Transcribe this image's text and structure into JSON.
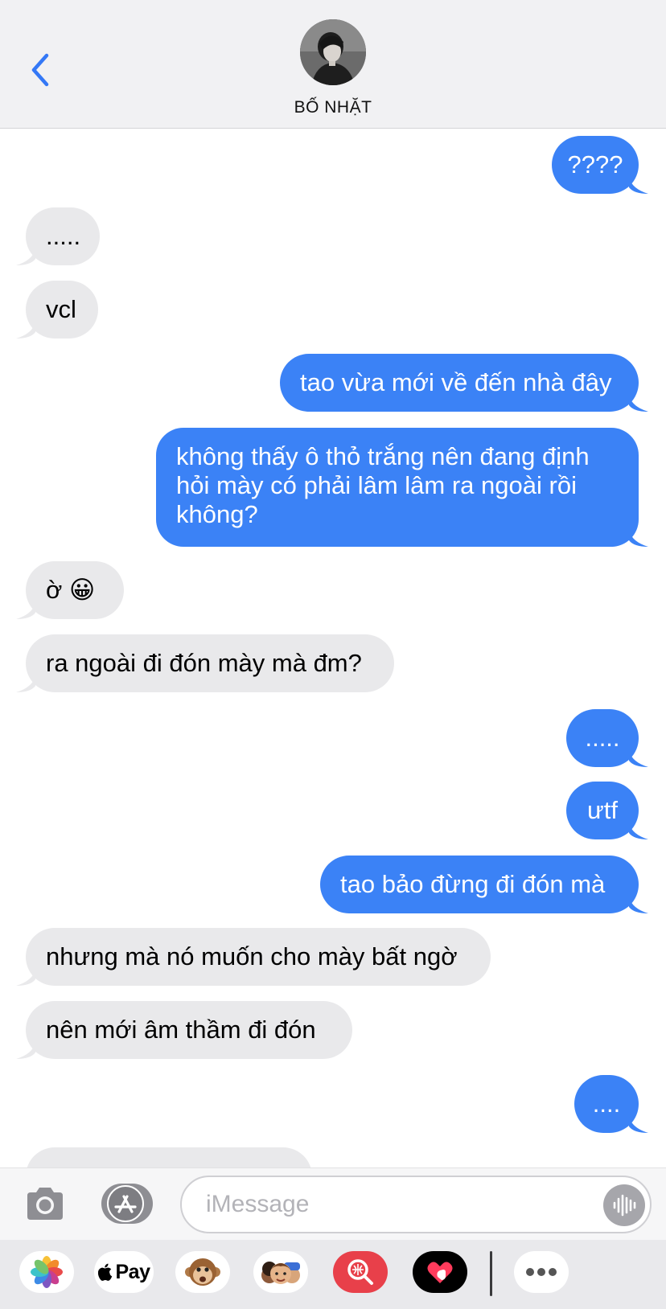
{
  "header": {
    "contact_name": "BỐ NHẶT",
    "back_icon": "chevron-left-icon",
    "accent_color": "#3478f6"
  },
  "messages": [
    {
      "from": "me",
      "text": "????"
    },
    {
      "from": "them",
      "text": "....."
    },
    {
      "from": "them",
      "text": "vcl"
    },
    {
      "from": "me",
      "text": "tao vừa mới về đến nhà đây"
    },
    {
      "from": "me",
      "text": "không thấy ô thỏ trắng nên đang định hỏi mày có phải lâm lâm ra ngoài rồi không?"
    },
    {
      "from": "them",
      "text": "ờ 😀"
    },
    {
      "from": "them",
      "text": "ra ngoài đi đón mày mà đm?"
    },
    {
      "from": "me",
      "text": "....."
    },
    {
      "from": "me",
      "text": "ưtf"
    },
    {
      "from": "me",
      "text": "tao bảo đừng đi đón mà"
    },
    {
      "from": "them",
      "text": "nhưng mà nó muốn cho mày bất ngờ"
    },
    {
      "from": "them",
      "text": "nên mới âm thầm đi đón"
    },
    {
      "from": "me",
      "text": "...."
    }
  ],
  "colors": {
    "outgoing_bubble": "#3b82f6",
    "incoming_bubble": "#e9e9eb"
  },
  "composer": {
    "placeholder": "iMessage",
    "camera_icon": "camera-icon",
    "apps_icon": "app-store-icon",
    "audio_icon": "audio-waveform-icon"
  },
  "app_drawer": {
    "apps": [
      "photos-icon",
      "apple-pay-icon",
      "monkey-animoji-icon",
      "memoji-icon",
      "image-search-icon",
      "digital-touch-icon",
      "more-icon"
    ],
    "apple_pay_label": "Pay"
  }
}
